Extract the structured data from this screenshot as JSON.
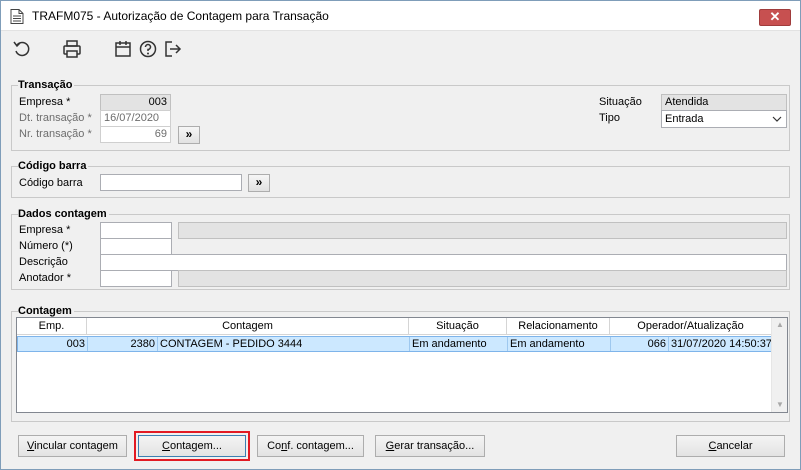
{
  "window": {
    "title": "TRAFM075 - Autorização de Contagem para Transação",
    "close_label": "✕"
  },
  "toolbar": {
    "icons": [
      "refresh-icon",
      "print-icon",
      "calendar-icon",
      "help-icon",
      "exit-icon"
    ]
  },
  "transacao": {
    "group_title": "Transação",
    "empresa_label": "Empresa *",
    "empresa_value": "003",
    "dt_label": "Dt. transação *",
    "dt_value": "16/07/2020",
    "nr_label": "Nr. transação *",
    "nr_value": "69",
    "nr_button": "»",
    "situacao_label": "Situação",
    "situacao_value": "Atendida",
    "tipo_label": "Tipo",
    "tipo_value": "Entrada"
  },
  "codigo_barra": {
    "group_title": "Código barra",
    "label": "Código barra",
    "value": "",
    "button": "»"
  },
  "dados": {
    "group_title": "Dados contagem",
    "empresa_label": "Empresa *",
    "empresa_value": "",
    "empresa_desc": "",
    "numero_label": "Número (*)",
    "numero_value": "",
    "descricao_label": "Descrição",
    "descricao_value": "",
    "anotador_label": "Anotador *",
    "anotador_value": "",
    "anotador_desc": ""
  },
  "contagem": {
    "group_title": "Contagem",
    "columns": [
      "Emp.",
      "Contagem",
      "Situação",
      "Relacionamento",
      "Operador/Atualização"
    ],
    "rows": [
      {
        "emp": "003",
        "num": "2380",
        "contagem": "CONTAGEM - PEDIDO 3444",
        "situacao": "Em andamento",
        "relacionamento": "Em andamento",
        "operador": "066",
        "atualizacao": "31/07/2020 14:50:37"
      }
    ]
  },
  "buttons": {
    "vincular_u": "V",
    "vincular_rest": "incular contagem",
    "contagem_u": "C",
    "contagem_rest": "ontagem...",
    "conf_pre": "Co",
    "conf_u": "n",
    "conf_rest": "f. contagem...",
    "gerar_u": "G",
    "gerar_rest": "erar transação...",
    "cancelar_u": "C",
    "cancelar_rest": "ancelar"
  },
  "colors": {
    "selection": "#cce8ff",
    "focus_highlight": "#e21a23",
    "close_button": "#c75050"
  }
}
